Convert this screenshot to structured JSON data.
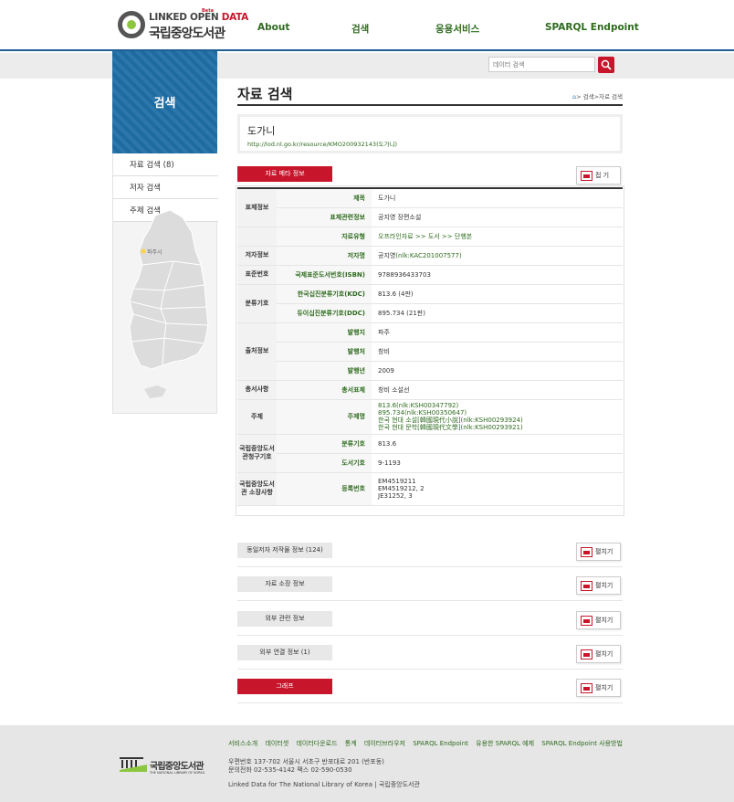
{
  "header": {
    "logo": {
      "line1_a": "LINKED OPEN ",
      "line1_b": "DATA",
      "beta": "Beta",
      "line2": "국립중앙도서관"
    },
    "nav": [
      "About",
      "검색",
      "응용서비스",
      "SPARQL Endpoint"
    ]
  },
  "search": {
    "placeholder": "데이터 검색"
  },
  "sidebar": {
    "title": "검색",
    "items": [
      "자료 검색 (8)",
      "저자 검색",
      "주제 검색"
    ],
    "map_label": "파주시"
  },
  "content": {
    "page_title": "자료 검색",
    "breadcrumb": "> 검색>자료 검색",
    "resource": {
      "title": "도가니",
      "uri": "http://lod.nl.go.kr/resource/KMO200932143(도가니)"
    },
    "meta_button": "자료 메타 정보",
    "fold_label": "접 기",
    "expand_label": "펼치기",
    "rows": [
      {
        "group": "표제정보",
        "key": "제목",
        "value": "도가니"
      },
      {
        "key": "표제관련정보",
        "value": "공지영 장편소설"
      },
      {
        "group": "",
        "key": "자료유형",
        "value": "오프라인자료 >> 도서 >> 단행본",
        "link": true
      },
      {
        "group": "저자정보",
        "key": "저자명",
        "value_a": "공지영",
        "value_b": "(nlk:KAC201007577)"
      },
      {
        "group": "표준번호",
        "key": "국제표준도서번호(ISBN)",
        "value": "9788936433703"
      },
      {
        "group": "분류기호",
        "key": "한국십진분류기호(KDC)",
        "value": "813.6 (4판)"
      },
      {
        "key": "듀이십진분류기호(DDC)",
        "value": "895.734 (21판)"
      },
      {
        "group": "출처정보",
        "key": "발행지",
        "value": "파주"
      },
      {
        "key": "발행처",
        "value": "창비"
      },
      {
        "key": "발행년",
        "value": "2009"
      },
      {
        "group": "총서사항",
        "key": "총서표제",
        "value": "창비 소설선"
      },
      {
        "group": "주제",
        "key": "주제명",
        "lines": [
          "813.6(nlk:KSH00347792)",
          "895.734(nlk:KSH00350647)",
          "한국 현대 소설[韓國現代小說](nlk:KSH00293924)",
          "한국 현대 문학[韓國現代文學](nlk:KSH00293921)"
        ]
      },
      {
        "group": "국립중앙도서관청구기호",
        "key": "분류기호",
        "value": "813.6"
      },
      {
        "key": "도서기호",
        "value": "9-1193"
      },
      {
        "group": "국립중앙도서관 소장사항",
        "key": "등록번호",
        "lines": [
          "EM4519211",
          "EM4519212, 2",
          "JE31252, 3"
        ]
      }
    ],
    "sections": [
      "동일저자 저작물 정보 (124)",
      "자료 소장 정보",
      "외부 관련 정보",
      "외부 연결 정보 (1)",
      "그래프"
    ]
  },
  "footer": {
    "links": [
      "서비스소개",
      "데이터셋",
      "데이터다운로드",
      "통계",
      "데이터브라우저",
      "SPARQL Endpoint",
      "유용한 SPARQL 예제",
      "SPARQL Endpoint 사용방법"
    ],
    "logo_text": "국립중앙도서관",
    "logo_sub": "THE NATIONAL LIBRARY OF KOREA",
    "address": "우편번호 137-702 서울시 서초구 반포대로 201 (반포동)",
    "contact": "문의전화 02-535-4142 팩스 02-590-0530",
    "copyright": "Linked Data for The National Library of Korea | 국립중앙도서관"
  },
  "colors": {
    "brand_blue": "#1f6ea6",
    "accent_red": "#c7162b",
    "link_green": "#2e6b1e"
  }
}
